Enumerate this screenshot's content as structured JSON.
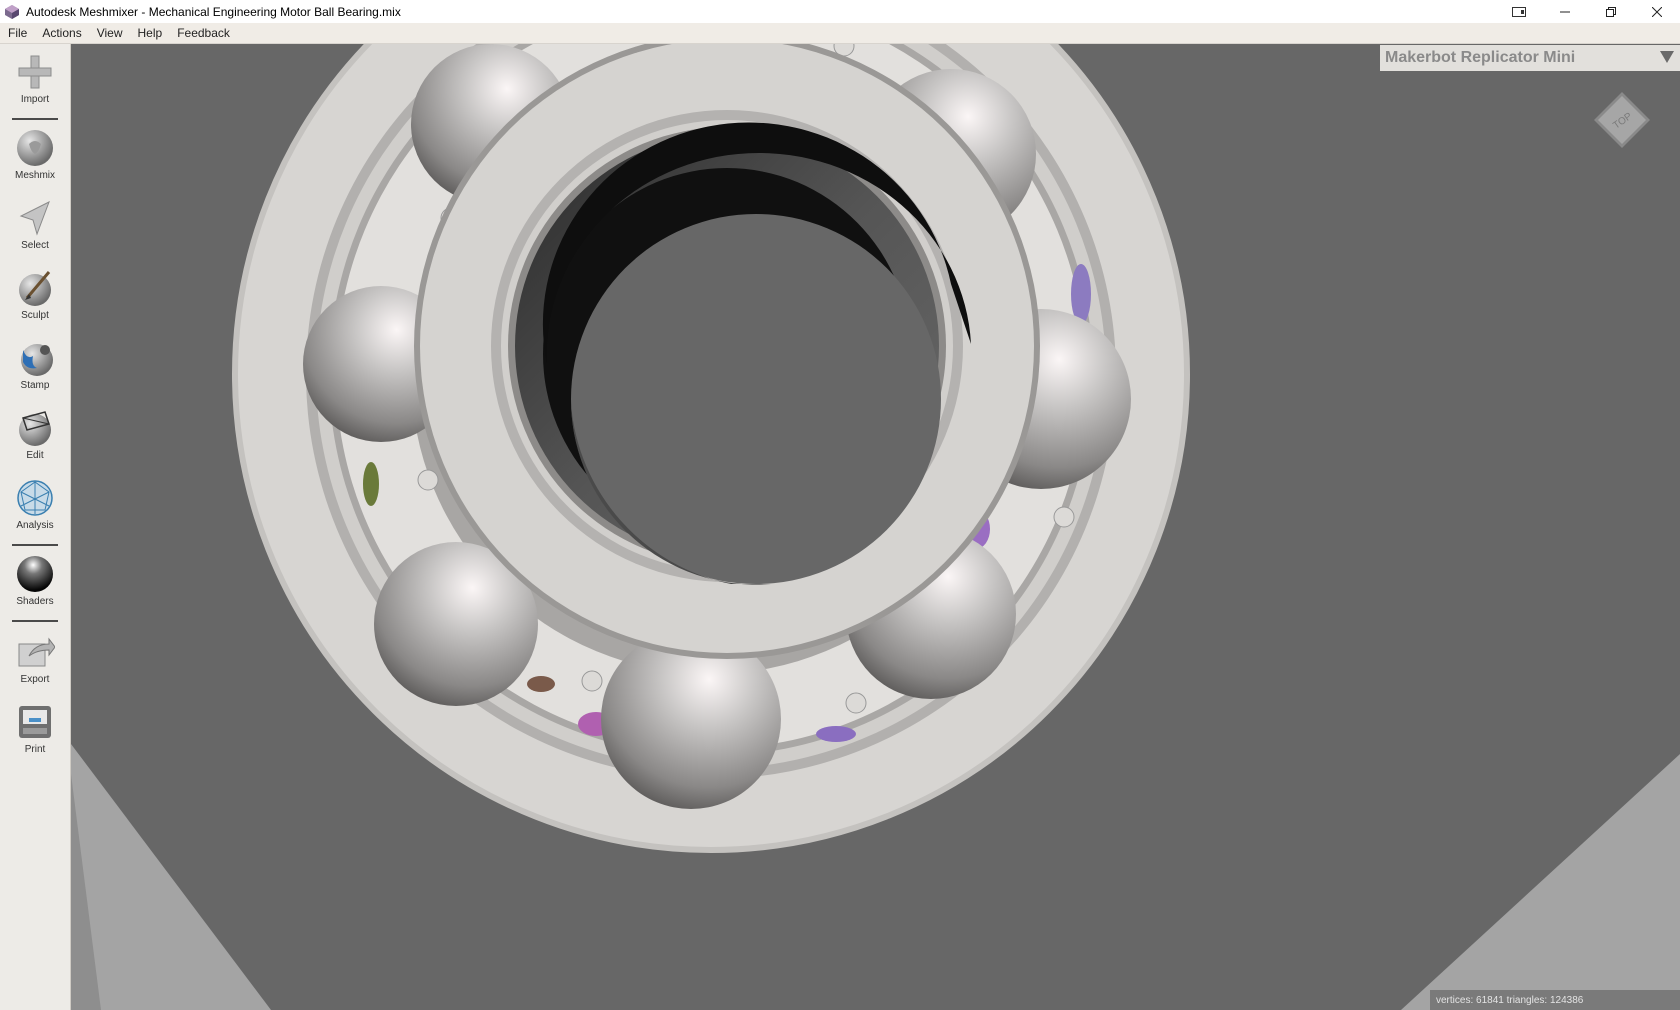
{
  "window": {
    "title": "Autodesk Meshmixer - Mechanical Engineering Motor Ball Bearing.mix"
  },
  "menu": {
    "items": [
      "File",
      "Actions",
      "View",
      "Help",
      "Feedback"
    ]
  },
  "tools": [
    {
      "label": "Import",
      "icon": "plus-icon"
    },
    {
      "label": "Meshmix",
      "icon": "meshmix-icon"
    },
    {
      "label": "Select",
      "icon": "select-arrow-icon"
    },
    {
      "label": "Sculpt",
      "icon": "sculpt-brush-icon"
    },
    {
      "label": "Stamp",
      "icon": "stamp-icon"
    },
    {
      "label": "Edit",
      "icon": "edit-icon"
    },
    {
      "label": "Analysis",
      "icon": "analysis-icon"
    },
    {
      "label": "Shaders",
      "icon": "shaders-sphere-icon"
    },
    {
      "label": "Export",
      "icon": "export-icon"
    },
    {
      "label": "Print",
      "icon": "printer-icon"
    }
  ],
  "printer": {
    "name": "Makerbot Replicator Mini"
  },
  "viewcube": {
    "face": "TOP"
  },
  "status": {
    "text": "vertices: 61841 triangles: 124386"
  },
  "colors": {
    "viewport_bg": "#676767",
    "toolbar_bg": "#edebe7",
    "bearing_gray": "#d4d2cf"
  }
}
